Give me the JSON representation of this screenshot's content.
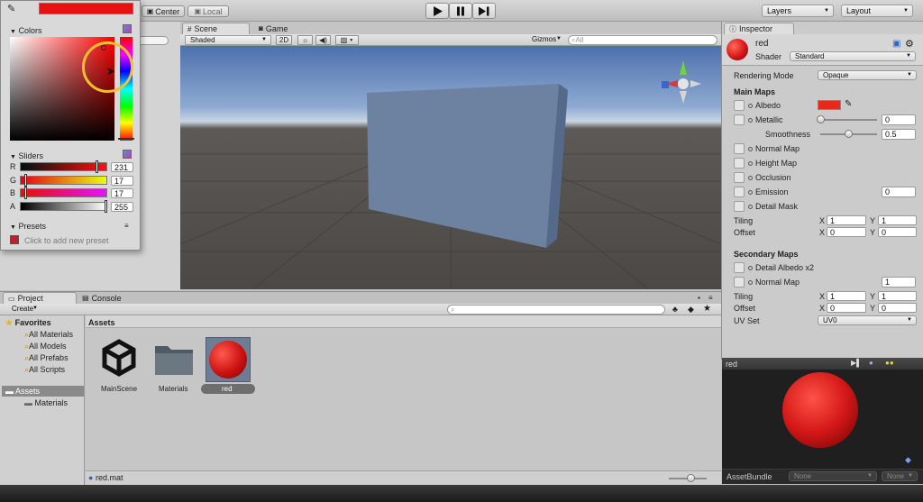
{
  "toolbar": {
    "center_label": "Center",
    "local_label": "Local",
    "layers_label": "Layers",
    "layout_label": "Layout"
  },
  "color_picker": {
    "swatch_color": "#e71111",
    "colors_label": "Colors",
    "sliders_label": "Sliders",
    "channels": [
      {
        "label": "R",
        "value": "231",
        "fraction": 0.906
      },
      {
        "label": "G",
        "value": "17",
        "fraction": 0.067
      },
      {
        "label": "B",
        "value": "17",
        "fraction": 0.067
      },
      {
        "label": "A",
        "value": "255",
        "fraction": 1.0
      }
    ],
    "presets_label": "Presets",
    "add_preset_text": "Click to add new preset"
  },
  "scene": {
    "scene_tab": "Scene",
    "game_tab": "Game",
    "shading": "Shaded",
    "mode_2d": "2D",
    "gizmos": "Gizmos",
    "search_placeholder": "All"
  },
  "inspector": {
    "tab": "Inspector",
    "material_name": "red",
    "shader_label": "Shader",
    "shader_value": "Standard",
    "rendering_mode_label": "Rendering Mode",
    "rendering_mode_value": "Opaque",
    "main_maps": "Main Maps",
    "albedo": "Albedo",
    "albedo_color": "#e7281a",
    "metallic": "Metallic",
    "metallic_value": "0",
    "metallic_fraction": 0.0,
    "smoothness": "Smoothness",
    "smoothness_value": "0.5",
    "smoothness_fraction": 0.5,
    "normal_map": "Normal Map",
    "height_map": "Height Map",
    "occlusion": "Occlusion",
    "emission": "Emission",
    "emission_value": "0",
    "detail_mask": "Detail Mask",
    "tiling": "Tiling",
    "offset": "Offset",
    "x": "X",
    "y": "Y",
    "tiling_x": "1",
    "tiling_y": "1",
    "offset_x": "0",
    "offset_y": "0",
    "secondary_maps": "Secondary Maps",
    "detail_albedo": "Detail Albedo x2",
    "secondary_normal_map": "Normal Map",
    "secondary_normal_value": "1",
    "tiling2_x": "1",
    "tiling2_y": "1",
    "offset2_x": "0",
    "offset2_y": "0",
    "uv_set": "UV Set",
    "uv_set_value": "UV0"
  },
  "preview": {
    "name": "red",
    "asset_bundle": "AssetBundle",
    "bundle_value": "None",
    "variant_value": "None"
  },
  "project": {
    "project_tab": "Project",
    "console_tab": "Console",
    "create_label": "Create",
    "favorites": "Favorites",
    "favorite_items": [
      "All Materials",
      "All Models",
      "All Prefabs",
      "All Scripts"
    ],
    "assets_root": "Assets",
    "assets_child": "Materials",
    "assets_header": "Assets",
    "assets": [
      {
        "name": "MainScene"
      },
      {
        "name": "Materials"
      },
      {
        "name": "red"
      }
    ],
    "selected_path": "red.mat"
  }
}
